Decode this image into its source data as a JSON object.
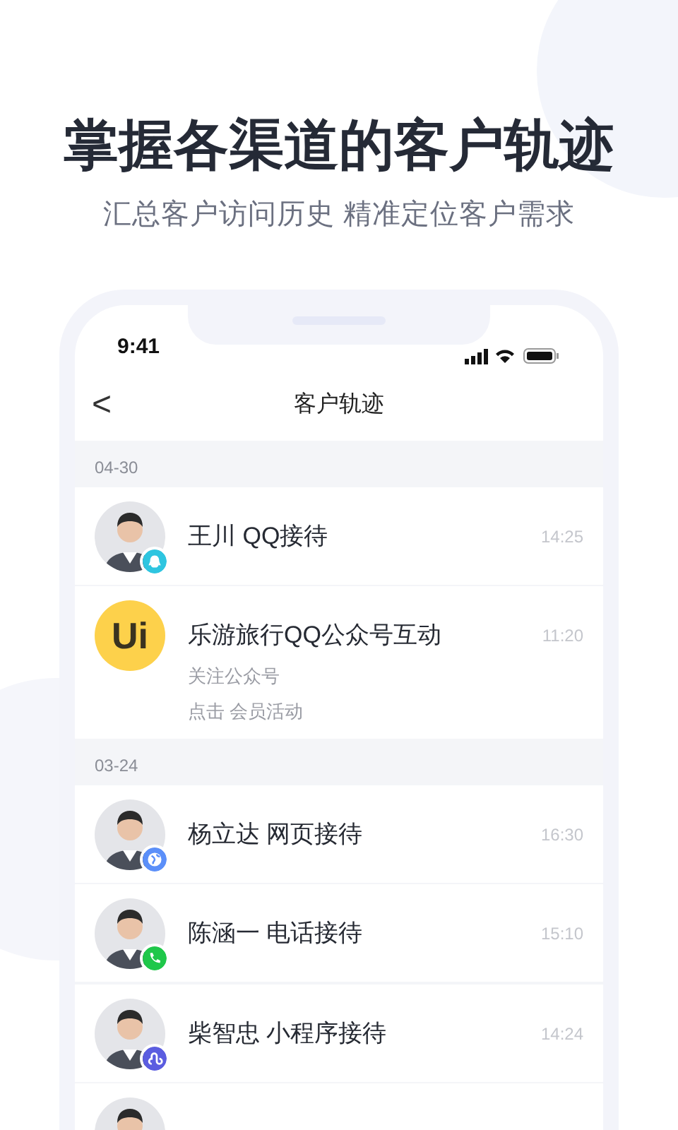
{
  "headline": "掌握各渠道的客户轨迹",
  "subheadline": "汇总客户访问历史 精准定位客户需求",
  "status_bar": {
    "time": "9:41"
  },
  "nav": {
    "back": "<",
    "title": "客户轨迹"
  },
  "groups": [
    {
      "date": "04-30",
      "items": [
        {
          "kind": "person",
          "badge": {
            "kind": "qq",
            "color": "#2ec5e0"
          },
          "name": "王川 QQ接待",
          "time": "14:25"
        },
        {
          "kind": "logo",
          "logo_text": "Ui",
          "name": "乐游旅行QQ公众号互动",
          "time": "11:20",
          "lines": [
            "关注公众号",
            "点击 会员活动"
          ]
        }
      ]
    },
    {
      "date": "03-24",
      "items": [
        {
          "kind": "person",
          "badge": {
            "kind": "web",
            "color": "#5b8ff9"
          },
          "name": "杨立达 网页接待",
          "time": "16:30"
        },
        {
          "kind": "person",
          "badge": {
            "kind": "phone",
            "color": "#1fc74a"
          },
          "name": "陈涵一 电话接待",
          "time": "15:10"
        },
        {
          "kind": "person",
          "badge": {
            "kind": "miniprogram",
            "color": "#5b5de0"
          },
          "name": "柴智忠 小程序接待",
          "time": "14:24"
        },
        {
          "kind": "person"
        }
      ]
    }
  ]
}
